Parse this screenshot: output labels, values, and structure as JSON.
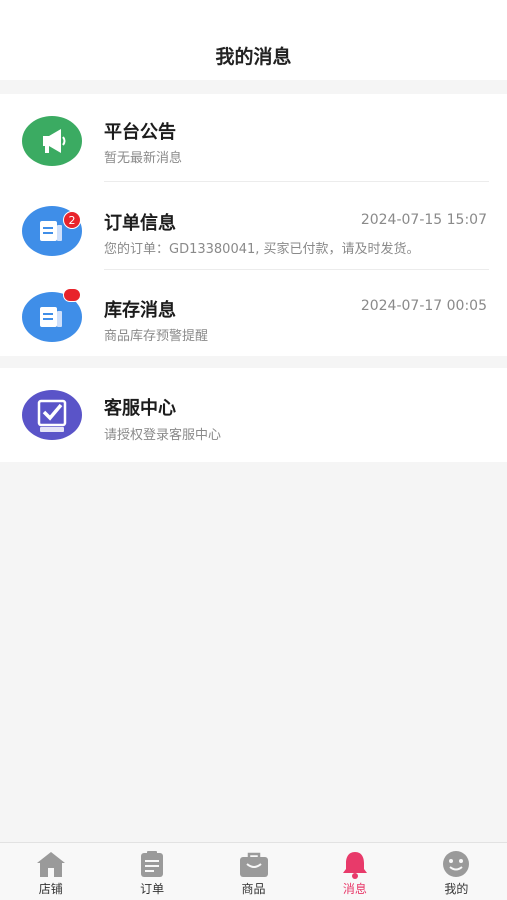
{
  "header": {
    "title": "我的消息"
  },
  "messages": [
    {
      "title": "平台公告",
      "subtitle": "暂无最新消息",
      "time": "",
      "icon": "megaphone-icon",
      "color": "#3bab62"
    },
    {
      "title": "订单信息",
      "subtitle": "您的订单：GD13380041, 买家已付款，请及时发货。",
      "time": "2024-07-15 15:07",
      "icon": "document-icon",
      "color": "#3f8ee8",
      "badge": "2"
    },
    {
      "title": "库存消息",
      "subtitle": "商品库存预警提醒",
      "time": "2024-07-17 00:05",
      "icon": "document-icon",
      "color": "#3f8ee8",
      "badge_dot": true
    },
    {
      "title": "客服中心",
      "subtitle": "请授权登录客服中心",
      "time": "",
      "icon": "shopping-bag-check-icon",
      "color": "#5a54c8"
    }
  ],
  "tabbar": {
    "items": [
      {
        "label": "店铺",
        "icon": "home-icon",
        "active": false
      },
      {
        "label": "订单",
        "icon": "clipboard-icon",
        "active": false
      },
      {
        "label": "商品",
        "icon": "bag-icon",
        "active": false
      },
      {
        "label": "消息",
        "icon": "bell-icon",
        "active": true
      },
      {
        "label": "我的",
        "icon": "smiley-icon",
        "active": false
      }
    ],
    "active_color": "#e83a6a",
    "inactive_color": "#9a9a9a"
  }
}
